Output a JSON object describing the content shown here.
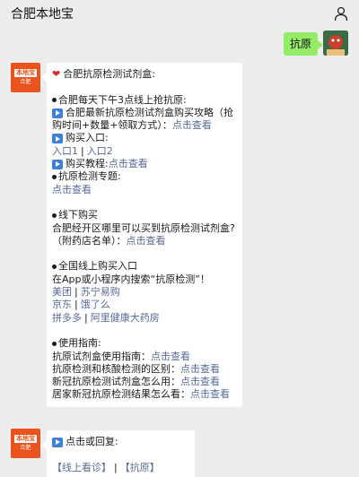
{
  "header": {
    "title": "合肥本地宝",
    "person_icon": "person-icon"
  },
  "user_message": {
    "text": "抗原",
    "avatar": "user-avatar"
  },
  "bot": {
    "brand": "本地宝",
    "city": "合肥"
  },
  "message1": {
    "title": "合肥抗原检测试剂盒:",
    "s1_heading": "合肥每天下午3点线上抢抗原:",
    "s1_item_text_a": "合肥最新抗原检测试剂盒购买攻略（抢",
    "s1_item_text_b": "购时间+数量+领取方式）：",
    "s1_item_link": "点击查看",
    "buy_entry_label": "购买入口:",
    "entry1": "入口1",
    "entry_sep": "|",
    "entry2": "入口2",
    "tutorial_label": "购买教程:",
    "tutorial_link": "点击查看",
    "topic_heading": "抗原检测专题:",
    "topic_link": "点击查看",
    "offline_heading": "线下购买",
    "offline_q_a": "合肥经开区哪里可以买到抗原检测试剂盒?",
    "offline_q_b": "（附药店名单）：",
    "offline_link": "点击查看",
    "online_heading": "全国线上购买入口",
    "online_desc": "在App或小程序内搜索“抗原检测”！",
    "shops": [
      [
        "美团",
        "苏宁易购"
      ],
      [
        "京东",
        "饿了么"
      ],
      [
        "拼多多",
        "阿里健康大药房"
      ]
    ],
    "guide_heading": "使用指南:",
    "guide_items": [
      {
        "text": "抗原试剂盒使用指南：",
        "link": "点击查看"
      },
      {
        "text": "抗原检测和核酸检测的区别：",
        "link": "点击查看"
      },
      {
        "text": "新冠抗原检测试剂盒怎么用：",
        "link": "点击查看"
      },
      {
        "text": "居家新冠抗原检测结果怎么看：",
        "link": "点击查看"
      }
    ]
  },
  "message2": {
    "prompt": "点击或回复:",
    "item1": "【线上看诊】",
    "sep": "|",
    "item2": "【抗原】"
  }
}
